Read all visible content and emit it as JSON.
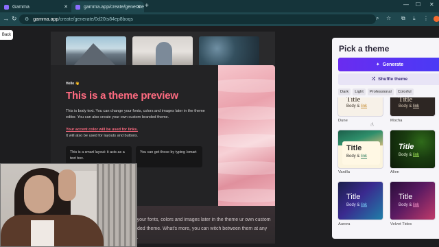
{
  "browser": {
    "tabs": [
      {
        "title": "Gamma",
        "active": false
      },
      {
        "title": "gamma.app/create/generate",
        "active": true
      }
    ],
    "url_host": "gamma.app",
    "url_path": "/create/generate/0d20ts84ep8boqs"
  },
  "app": {
    "back_label": "Back"
  },
  "preview": {
    "hello": "Hello 👋",
    "title": "This is a theme preview",
    "body": "This is body text. You can change your fonts, colors and images later in the theme editor. You can also create your own custom branded theme.",
    "accent": "Your accent color will be used for links.",
    "accent_sub": "It will also be used for layouts and buttons.",
    "box1": "This is a smart layout: it acts as a text box.",
    "box2": "You can get these by typing /smart",
    "bottom": "nge your fonts, colors and images later in the theme ur own custom branded theme. What's more, you can witch between them at any time."
  },
  "panel": {
    "title": "Pick a theme",
    "generate_label": "Generate",
    "shuffle_label": "Shuffle theme",
    "filters": [
      "Dark",
      "Light",
      "Professional",
      "Colorful"
    ],
    "themes": [
      {
        "name": "Dune",
        "title": "Title",
        "body": "Body &",
        "link": "link"
      },
      {
        "name": "Mocha",
        "title": "Title",
        "body": "Body &",
        "link": "link"
      },
      {
        "name": "Vanilla",
        "title": "Title",
        "body": "Body &",
        "link": "link"
      },
      {
        "name": "Alien",
        "title": "Title",
        "body": "Body &",
        "link": "link"
      },
      {
        "name": "Aurora",
        "title": "Title",
        "body": "Body &",
        "link": "link"
      },
      {
        "name": "Velvet Tides",
        "title": "Title",
        "body": "Body &",
        "link": "link"
      }
    ]
  },
  "colors": {
    "accent_pink": "#ff6b81",
    "generate_purple": "#5a34f2",
    "chrome_teal": "#1f474e"
  }
}
